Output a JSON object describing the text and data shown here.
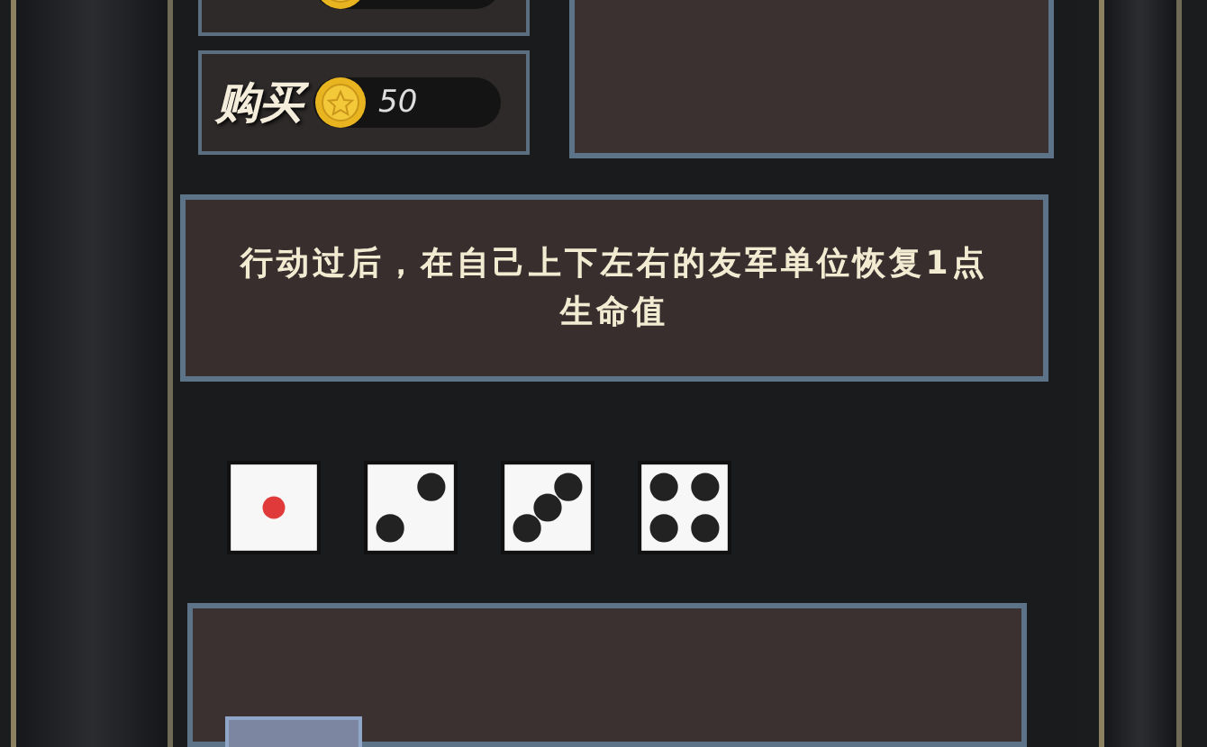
{
  "buy_button": {
    "label": "购买",
    "price": "50"
  },
  "skill_description": "行动过后，在自己上下左右的友军单位恢复1点生命值",
  "dice": [
    {
      "kind": "one"
    },
    {
      "kind": "two"
    },
    {
      "kind": "three"
    },
    {
      "kind": "four"
    }
  ]
}
